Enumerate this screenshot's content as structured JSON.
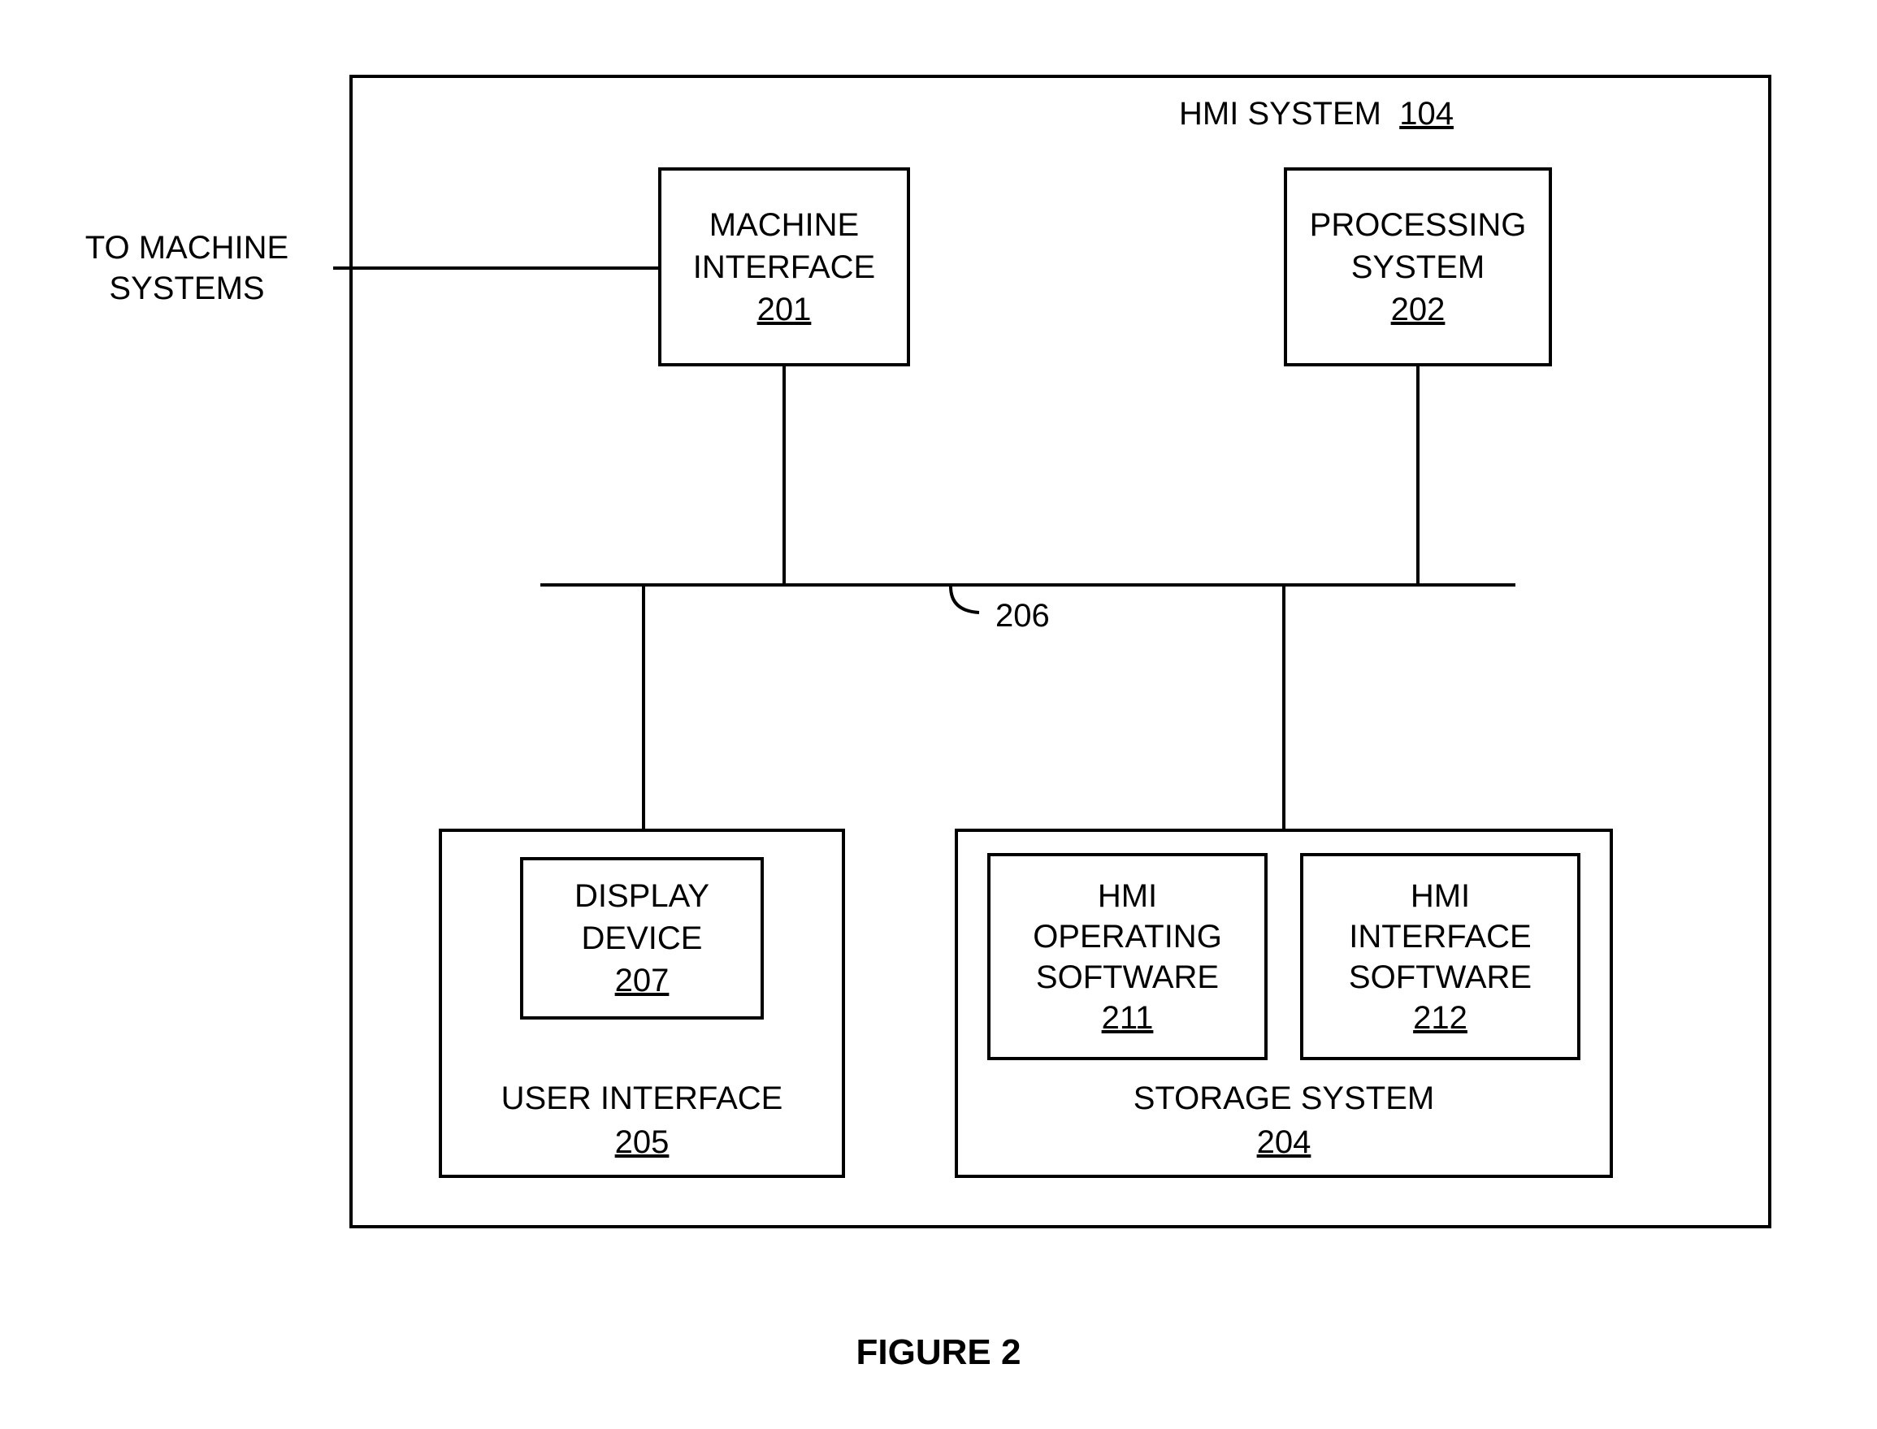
{
  "external_label": "TO MACHINE\nSYSTEMS",
  "outer": {
    "title": "HMI SYSTEM",
    "ref": "104"
  },
  "machine_interface": {
    "line1": "MACHINE",
    "line2": "INTERFACE",
    "ref": "201"
  },
  "processing_system": {
    "line1": "PROCESSING",
    "line2": "SYSTEM",
    "ref": "202"
  },
  "bus_label": "206",
  "user_interface": {
    "title": "USER INTERFACE",
    "ref": "205"
  },
  "display_device": {
    "line1": "DISPLAY",
    "line2": "DEVICE",
    "ref": "207"
  },
  "storage_system": {
    "title": "STORAGE SYSTEM",
    "ref": "204"
  },
  "hmi_operating_sw": {
    "line1": "HMI",
    "line2": "OPERATING",
    "line3": "SOFTWARE",
    "ref": "211"
  },
  "hmi_interface_sw": {
    "line1": "HMI",
    "line2": "INTERFACE",
    "line3": "SOFTWARE",
    "ref": "212"
  },
  "figure_caption": "FIGURE 2"
}
